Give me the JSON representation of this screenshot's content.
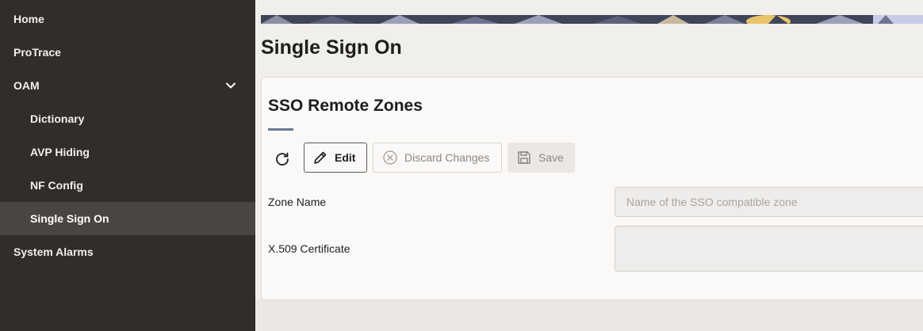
{
  "sidebar": {
    "items": [
      {
        "label": "Home"
      },
      {
        "label": "ProTrace"
      },
      {
        "label": "OAM"
      },
      {
        "label": "Dictionary"
      },
      {
        "label": "AVP Hiding"
      },
      {
        "label": "NF Config"
      },
      {
        "label": "Single Sign On"
      },
      {
        "label": "System Alarms"
      }
    ]
  },
  "page": {
    "title": "Single Sign On"
  },
  "card": {
    "title": "SSO Remote Zones",
    "toolbar": {
      "edit_label": "Edit",
      "discard_label": "Discard Changes",
      "save_label": "Save"
    },
    "fields": {
      "zone_name_label": "Zone Name",
      "zone_name_placeholder": "Name of the SSO compatible zone",
      "zone_name_value": "",
      "certificate_label": "X.509 Certificate",
      "certificate_value": ""
    }
  },
  "colors": {
    "sidebar_bg": "#312d2a",
    "sidebar_active_bg": "#4a4541",
    "accent_underline": "#6b7794"
  },
  "icons": [
    "chevron-down-icon",
    "refresh-icon",
    "pencil-icon",
    "cancel-circle-icon",
    "save-icon"
  ]
}
